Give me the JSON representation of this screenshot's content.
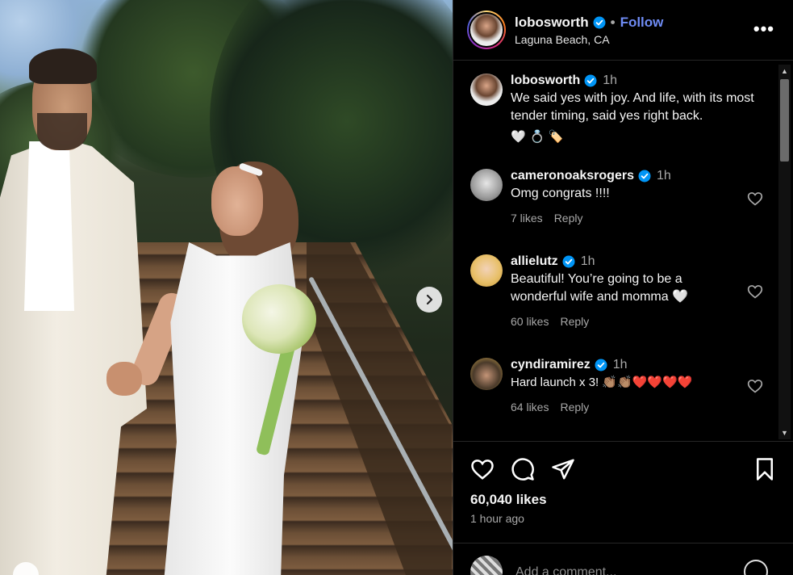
{
  "header": {
    "username": "lobosworth",
    "separator": "•",
    "follow_label": "Follow",
    "location": "Laguna Beach, CA",
    "more_label": "•••"
  },
  "photo": {
    "next_icon": "chevron-right-icon"
  },
  "caption": {
    "username": "lobosworth",
    "time": "1h",
    "text": "We said yes with joy. And life, with its most tender timing, said yes right back.",
    "emojis": "🤍 💍 🏷️"
  },
  "comments": [
    {
      "username": "cameronoaksrogers",
      "time": "1h",
      "text": "Omg congrats !!!!",
      "likes": "7 likes",
      "reply": "Reply"
    },
    {
      "username": "allielutz",
      "time": "1h",
      "text": "Beautiful! You’re going to be a wonderful wife and momma 🤍",
      "likes": "60 likes",
      "reply": "Reply"
    },
    {
      "username": "cyndiramirez",
      "time": "1h",
      "text": "Hard launch x 3! 👏🏽👏🏽❤️❤️❤️❤️",
      "likes": "64 likes",
      "reply": "Reply"
    }
  ],
  "post": {
    "likes": "60,040 likes",
    "time_ago": "1 hour ago"
  },
  "add_comment": {
    "placeholder": "Add a comment..."
  },
  "colors": {
    "background": "#000000",
    "follow": "#6f8cf5",
    "verified": "#0095f6",
    "muted": "#a8a8a8"
  }
}
